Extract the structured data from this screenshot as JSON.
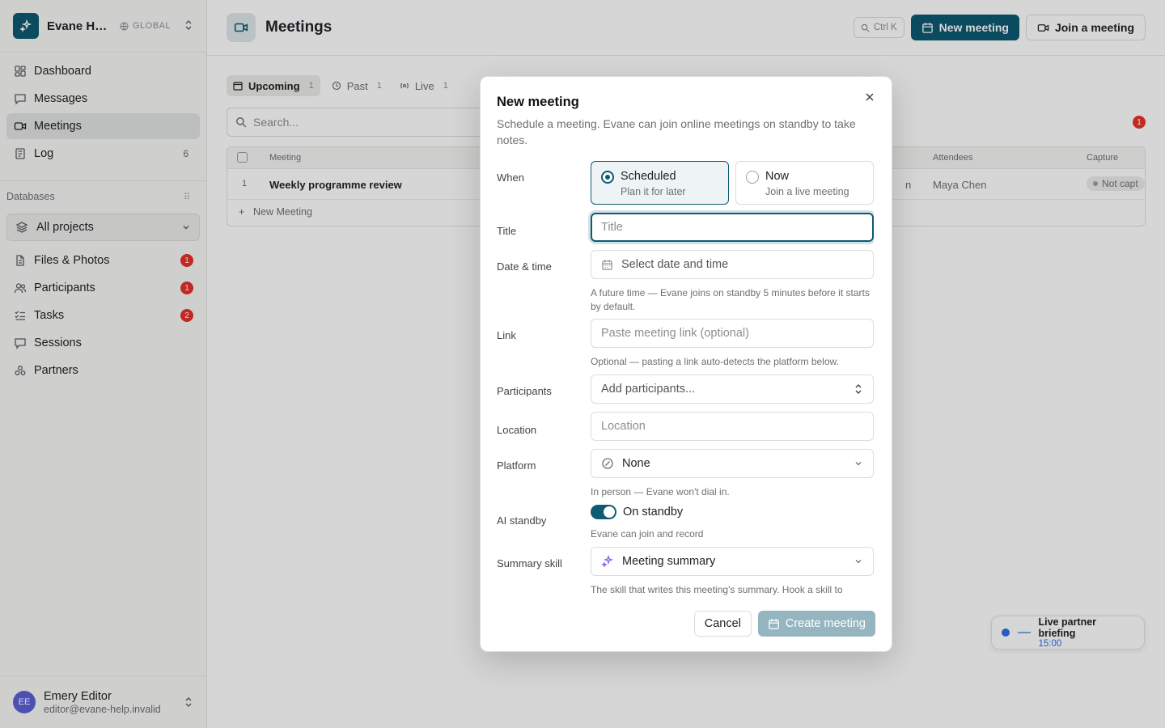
{
  "workspace": {
    "name": "Evane He...",
    "scope": "GLOBAL"
  },
  "sidebar": {
    "nav": [
      {
        "label": "Dashboard",
        "icon": "dashboard-icon"
      },
      {
        "label": "Messages",
        "icon": "message-icon"
      },
      {
        "label": "Meetings",
        "icon": "video-icon",
        "active": true
      },
      {
        "label": "Log",
        "icon": "log-icon",
        "count": "6"
      }
    ],
    "databases_label": "Databases",
    "project_select": "All projects",
    "db_items": [
      {
        "label": "Files & Photos",
        "icon": "file-icon",
        "badge": "1"
      },
      {
        "label": "Participants",
        "icon": "people-icon",
        "badge": "1"
      },
      {
        "label": "Tasks",
        "icon": "tasks-icon",
        "badge": "2"
      },
      {
        "label": "Sessions",
        "icon": "session-icon"
      },
      {
        "label": "Partners",
        "icon": "partners-icon"
      }
    ],
    "user": {
      "initials": "EE",
      "name": "Emery Editor",
      "email": "editor@evane-help.invalid"
    }
  },
  "main": {
    "title": "Meetings",
    "shortcut": "Ctrl K",
    "new_meeting": "New meeting",
    "join_meeting": "Join a meeting",
    "tabs": [
      {
        "label": "Upcoming",
        "count": "1",
        "active": true
      },
      {
        "label": "Past",
        "count": "1"
      },
      {
        "label": "Live",
        "count": "1"
      }
    ],
    "search_placeholder": "Search...",
    "filter_count": "1",
    "table": {
      "headers": {
        "meeting": "Meeting",
        "attendees": "Attendees",
        "capture": "Capture"
      },
      "rows": [
        {
          "index": "1",
          "meeting": "Weekly programme review",
          "partial": "n",
          "attendees": "Maya Chen",
          "capture": "Not capt"
        }
      ],
      "new_row": "New Meeting"
    },
    "live_toast": {
      "title": "Live partner briefing",
      "time": "15:00"
    }
  },
  "modal": {
    "title": "New meeting",
    "subtitle": "Schedule a meeting. Evane can join online meetings on standby to take notes.",
    "when_label": "When",
    "options": [
      {
        "title": "Scheduled",
        "sub": "Plan it for later",
        "selected": true
      },
      {
        "title": "Now",
        "sub": "Join a live meeting",
        "selected": false
      }
    ],
    "title_label": "Title",
    "title_placeholder": "Title",
    "datetime_label": "Date & time",
    "datetime_placeholder": "Select date and time",
    "datetime_hint": "A future time — Evane joins on standby 5 minutes before it starts by default.",
    "link_label": "Link",
    "link_placeholder": "Paste meeting link (optional)",
    "link_hint": "Optional — pasting a link auto-detects the platform below.",
    "participants_label": "Participants",
    "participants_placeholder": "Add participants...",
    "location_label": "Location",
    "location_placeholder": "Location",
    "platform_label": "Platform",
    "platform_value": "None",
    "platform_hint": "In person — Evane won't dial in.",
    "standby_label": "AI standby",
    "standby_value": "On standby",
    "standby_on": true,
    "standby_hint": "Evane can join and record",
    "skill_label": "Summary skill",
    "skill_value": "Meeting summary",
    "skill_hint": "The skill that writes this meeting's summary. Hook a skill to Meetings in Settings → Skills to add it here.",
    "cancel": "Cancel",
    "create": "Create meeting"
  },
  "colors": {
    "accent": "#0e5a73",
    "badge": "#e5332a",
    "avatar": "#5b5fd6"
  }
}
